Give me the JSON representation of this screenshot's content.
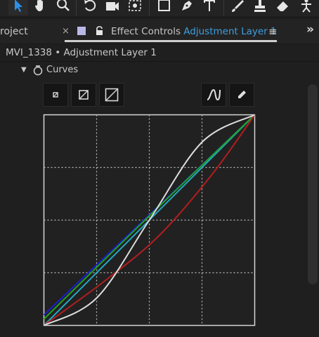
{
  "toolbar": {
    "tools": [
      {
        "icon": "selection-arrow-icon",
        "active": true
      },
      {
        "icon": "hand-icon"
      },
      {
        "icon": "zoom-icon"
      },
      {
        "icon": "rotate-icon"
      },
      {
        "icon": "camera-icon"
      },
      {
        "icon": "pan-behind-icon"
      },
      {
        "icon": "rectangle-icon"
      },
      {
        "icon": "pen-icon"
      },
      {
        "icon": "type-icon"
      },
      {
        "icon": "brush-icon"
      },
      {
        "icon": "clone-stamp-icon"
      },
      {
        "icon": "eraser-icon"
      },
      {
        "icon": "puppet-icon"
      }
    ]
  },
  "tabs": {
    "project_label": "roject",
    "close_label": "×",
    "effect_controls_label": "Effect Controls",
    "layer_label": "Adjustment Layer 1",
    "menu_label": "≡",
    "overflow_label": "»",
    "swatch_color": "#b9b8e6",
    "accent_color": "#3f9fe0"
  },
  "panel": {
    "header": "MVI_1338 • Adjustment Layer 1"
  },
  "effect": {
    "expand_glyph": "▼",
    "name": "Curves",
    "buttons": [
      {
        "icon": "small-curve-size-icon"
      },
      {
        "icon": "medium-curve-size-icon"
      },
      {
        "icon": "large-curve-size-icon"
      },
      {
        "icon": "smooth-curve-icon"
      },
      {
        "icon": "pencil-icon"
      }
    ]
  },
  "curves": {
    "type": "line",
    "xlim": [
      0,
      1
    ],
    "ylim": [
      0,
      1
    ],
    "grid": true,
    "series": [
      {
        "color": "#1d1fc8",
        "points": [
          [
            0,
            0.05
          ],
          [
            1,
            1
          ]
        ]
      },
      {
        "color": "#25a8c2",
        "points": [
          [
            0,
            0
          ],
          [
            1,
            1
          ]
        ]
      },
      {
        "color": "#1fa125",
        "points": [
          [
            0,
            0.03
          ],
          [
            0.5,
            0.52
          ],
          [
            1,
            1
          ]
        ]
      },
      {
        "color": "#b11e1e",
        "points": [
          [
            0,
            0
          ],
          [
            0.3,
            0.22
          ],
          [
            0.55,
            0.43
          ],
          [
            0.8,
            0.72
          ],
          [
            1,
            1
          ]
        ]
      },
      {
        "color": "#dcdcdc",
        "points": [
          [
            0,
            0
          ],
          [
            0.25,
            0.13
          ],
          [
            0.5,
            0.5
          ],
          [
            0.75,
            0.87
          ],
          [
            1,
            1
          ]
        ]
      }
    ]
  }
}
